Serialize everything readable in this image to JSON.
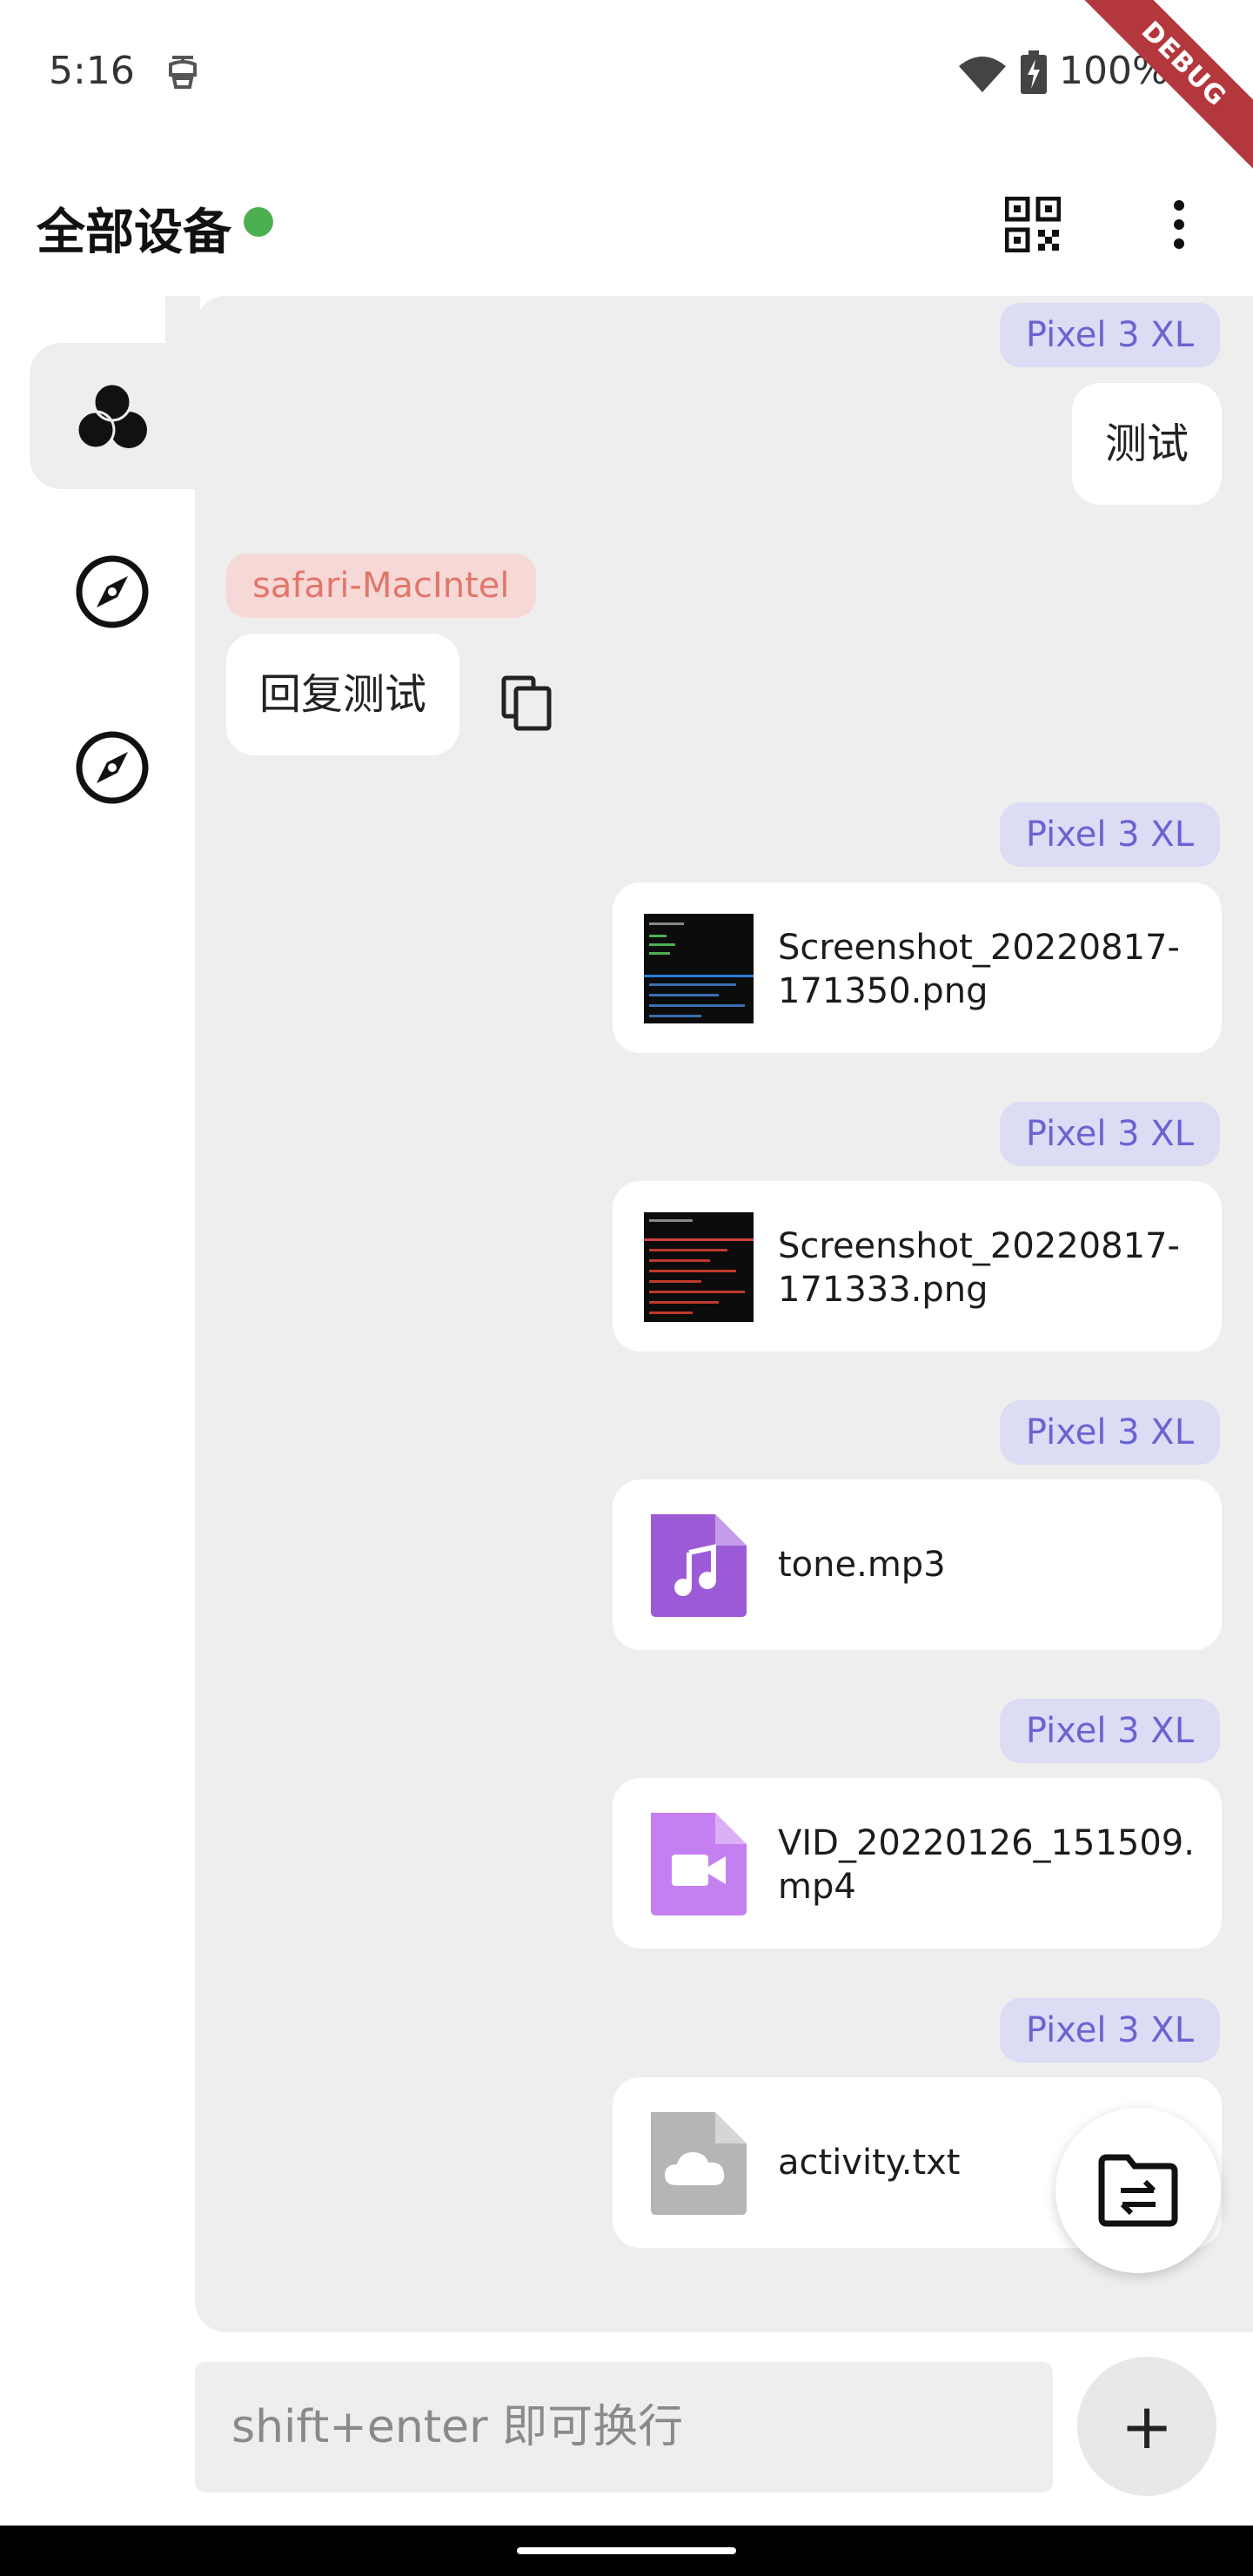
{
  "status_bar": {
    "time": "5:16",
    "battery": "100%",
    "debug_banner": "DEBUG"
  },
  "app_bar": {
    "title": "全部设备",
    "online_color": "#4caf50",
    "icons": [
      "qr-code-icon",
      "more-vert-icon"
    ]
  },
  "rail": {
    "items": [
      {
        "icon": "all-devices-icon",
        "selected": true
      },
      {
        "icon": "compass-icon",
        "selected": false
      },
      {
        "icon": "compass-icon",
        "selected": false
      }
    ]
  },
  "messages": [
    {
      "sender": "Pixel 3 XL",
      "type": "text",
      "text": "测试"
    },
    {
      "sender": "safari-MacIntel",
      "type": "text",
      "text": "回复测试"
    },
    {
      "sender": "Pixel 3 XL",
      "type": "image",
      "file_name": "Screenshot_20220817-171350.png"
    },
    {
      "sender": "Pixel 3 XL",
      "type": "image",
      "file_name": "Screenshot_20220817-171333.png"
    },
    {
      "sender": "Pixel 3 XL",
      "type": "audio",
      "file_name": "tone.mp3"
    },
    {
      "sender": "Pixel 3 XL",
      "type": "video",
      "file_name": "VID_20220126_151509.mp4"
    },
    {
      "sender": "Pixel 3 XL",
      "type": "file",
      "file_name": "activity.txt"
    }
  ],
  "input": {
    "placeholder": "shift+enter 即可换行",
    "value": ""
  },
  "colors": {
    "me_tag_bg": "#dcdcf4",
    "me_tag_text": "#6a64d2",
    "other_tag_bg": "#f6d9d6",
    "other_tag_text": "#e2766a",
    "audio_icon": "#9c5bd6",
    "video_icon": "#c47ff0",
    "file_icon": "#b5b5b5"
  }
}
